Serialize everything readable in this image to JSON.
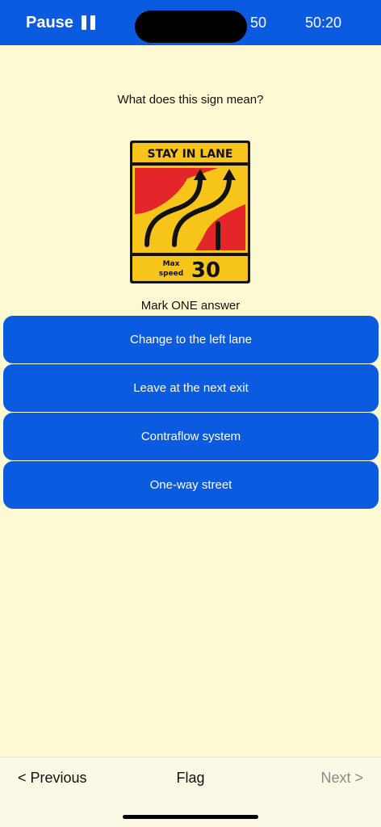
{
  "header": {
    "pause_label": "Pause",
    "question_counter": "50",
    "timer": "50:20",
    "pause_icon": "pause-icon"
  },
  "question": {
    "text": "What does this sign mean?",
    "instruction": "Mark ONE answer"
  },
  "sign": {
    "top_text": "STAY IN LANE",
    "max_label": "Max",
    "speed_label": "speed",
    "speed_value": "30",
    "colors": {
      "yellow": "#f7c51a",
      "red": "#e4262a",
      "black": "#111111"
    }
  },
  "answers": [
    {
      "label": "Change to the left lane"
    },
    {
      "label": "Leave at the next exit"
    },
    {
      "label": "Contraflow system"
    },
    {
      "label": "One-way street"
    }
  ],
  "footer": {
    "previous_label": "< Previous",
    "flag_label": "Flag",
    "next_label": "Next >"
  },
  "colors": {
    "accent": "#0a5be0",
    "background": "#fdf9d2",
    "disabled_text": "#8a8a8a"
  }
}
